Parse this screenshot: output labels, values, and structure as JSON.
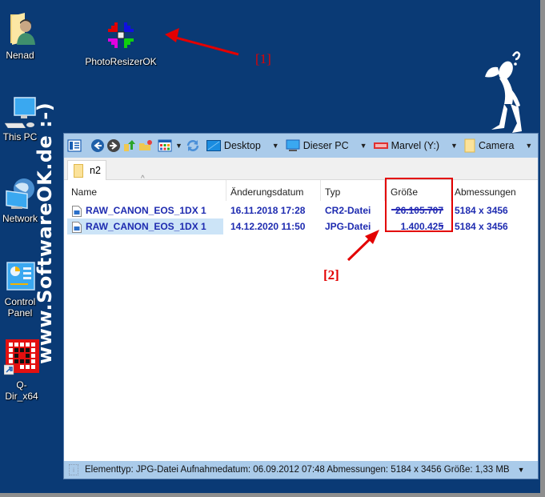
{
  "desktop": {
    "icons": [
      {
        "label": "Nenad",
        "icon": "user-folder-icon"
      },
      {
        "label": "PhotoResizerOK",
        "icon": "photoresizer-icon"
      },
      {
        "label": "This PC",
        "icon": "computer-icon"
      },
      {
        "label": "Network",
        "icon": "network-icon"
      },
      {
        "label": "Control Panel",
        "icon": "control-panel-icon"
      },
      {
        "label": "Q-Dir_x64",
        "icon": "qdir-icon"
      }
    ],
    "watermark": "www.SoftwareOK.de :-)",
    "annotations": {
      "one": "[1]",
      "two": "[2]"
    },
    "accent_color": "#e30000",
    "background_color": "#0a3a75"
  },
  "explorer": {
    "toolbar": {
      "buttons": [
        "view-pane-icon",
        "back-icon",
        "forward-icon",
        "up-folder-icon",
        "new-folder-icon",
        "view-mode-icon",
        "refresh-icon"
      ],
      "breadcrumbs": [
        {
          "label": "Desktop",
          "icon": "desktop-icon"
        },
        {
          "label": "Dieser PC",
          "icon": "computer-icon"
        },
        {
          "label": "Marvel (Y:)",
          "icon": "drive-icon"
        },
        {
          "label": "Camera",
          "icon": "folder-icon"
        }
      ]
    },
    "tab": {
      "label": "n2"
    },
    "columns": {
      "name": "Name",
      "date": "Änderungsdatum",
      "type": "Typ",
      "size": "Größe",
      "dims": "Abmessungen"
    },
    "files": [
      {
        "name": "RAW_CANON_EOS_1DX 1",
        "date": "16.11.2018 17:28",
        "type": "CR2-Datei",
        "size": "26.105.707",
        "dims": "5184 x 3456",
        "selected": false
      },
      {
        "name": "RAW_CANON_EOS_1DX 1",
        "date": "14.12.2020 11:50",
        "type": "JPG-Datei",
        "size": "1.400.425",
        "dims": "5184 x 3456",
        "selected": true
      }
    ],
    "status": "Elementtyp: JPG-Datei Aufnahmedatum: 06.09.2012 07:48 Abmessungen: 5184 x 3456 Größe: 1,33 MB"
  }
}
